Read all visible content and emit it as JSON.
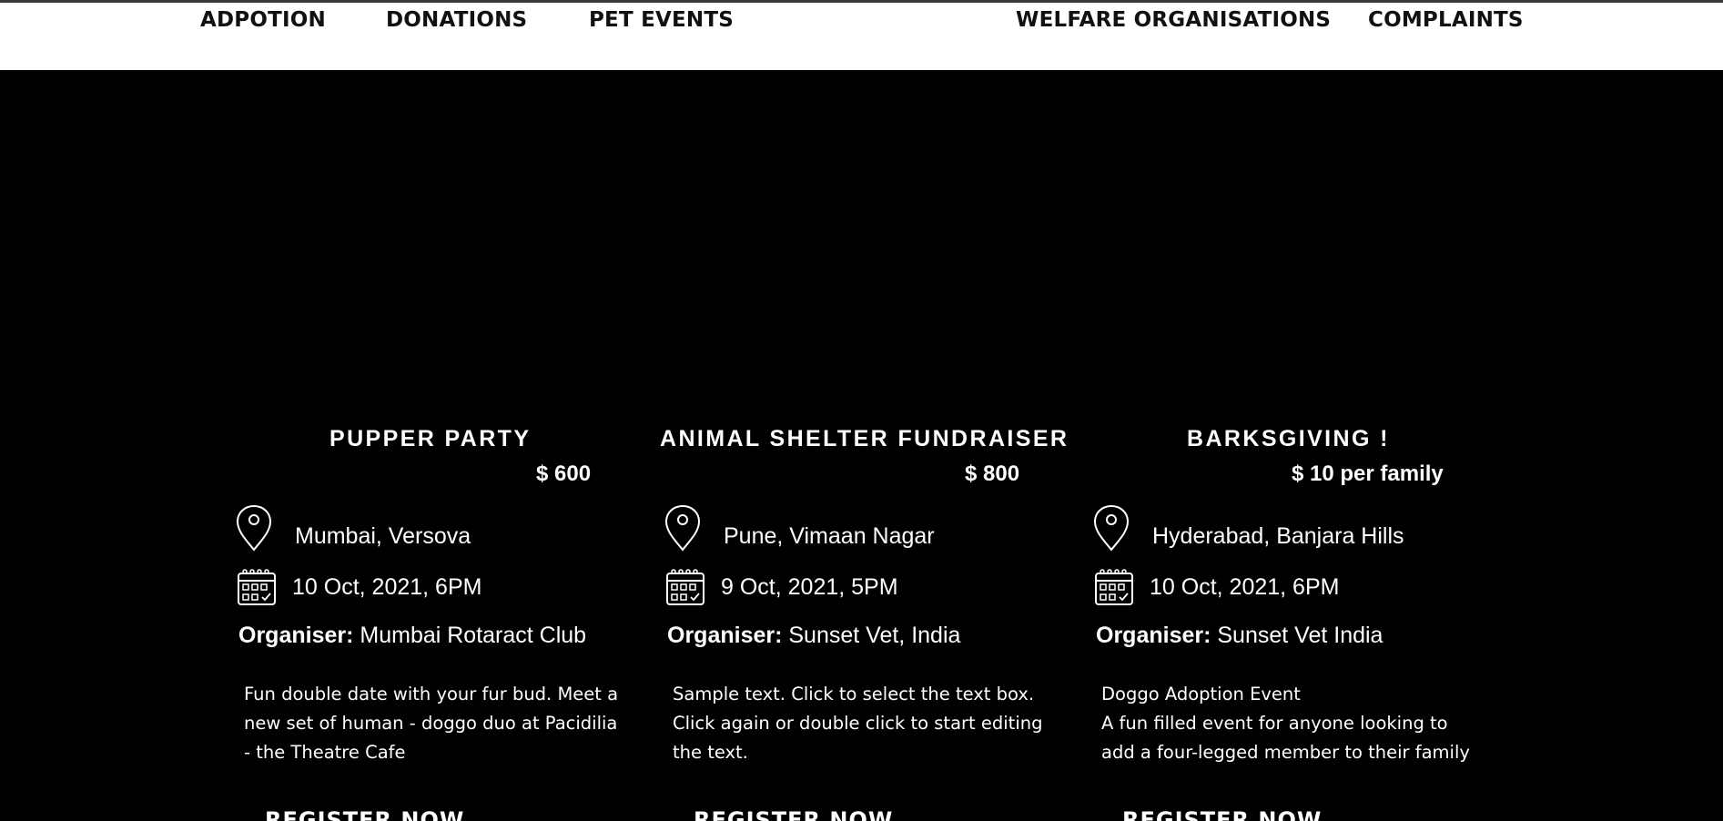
{
  "nav": {
    "items": [
      {
        "label": "ADPOTION"
      },
      {
        "label": "DONATIONS"
      },
      {
        "label": "PET EVENTS"
      },
      {
        "label": "WELFARE ORGANISATIONS"
      },
      {
        "label": "COMPLAINTS"
      }
    ]
  },
  "events": [
    {
      "title": "PUPPER PARTY",
      "price": "$ 600",
      "location": "Mumbai, Versova",
      "datetime": "10 Oct, 2021, 6PM",
      "organiser_label": "Organiser:",
      "organiser": " Mumbai Rotaract Club",
      "description": [
        "Fun double date with your fur bud. Meet a",
        "new set of human - doggo duo at Pacidilia",
        "- the Theatre Cafe"
      ],
      "register_label": "REGISTER NOW"
    },
    {
      "title": "ANIMAL SHELTER FUNDRAISER",
      "price": "$ 800",
      "location": "Pune, Vimaan Nagar",
      "datetime": "9 Oct, 2021, 5PM",
      "organiser_label": "Organiser:",
      "organiser": " Sunset Vet, India",
      "description": [
        "Sample text. Click to select the text box.",
        "Click again or double click to start editing",
        "the text."
      ],
      "register_label": "REGISTER NOW"
    },
    {
      "title": "BARKSGIVING !",
      "price": "$ 10  per family",
      "location": "Hyderabad, Banjara Hills",
      "datetime": "10 Oct, 2021, 6PM",
      "organiser_label": "Organiser:",
      "organiser": " Sunset Vet India",
      "description": [
        "Doggo Adoption Event",
        "A fun filled event for anyone looking to",
        "add a four-legged member to their family"
      ],
      "register_label": "REGISTER NOW"
    }
  ],
  "icons": {
    "location": "map-pin-icon",
    "date": "calendar-icon"
  },
  "colors": {
    "background": "#000000",
    "navbar": "#ffffff",
    "nav_text": "#111111",
    "text": "#ffffff"
  }
}
